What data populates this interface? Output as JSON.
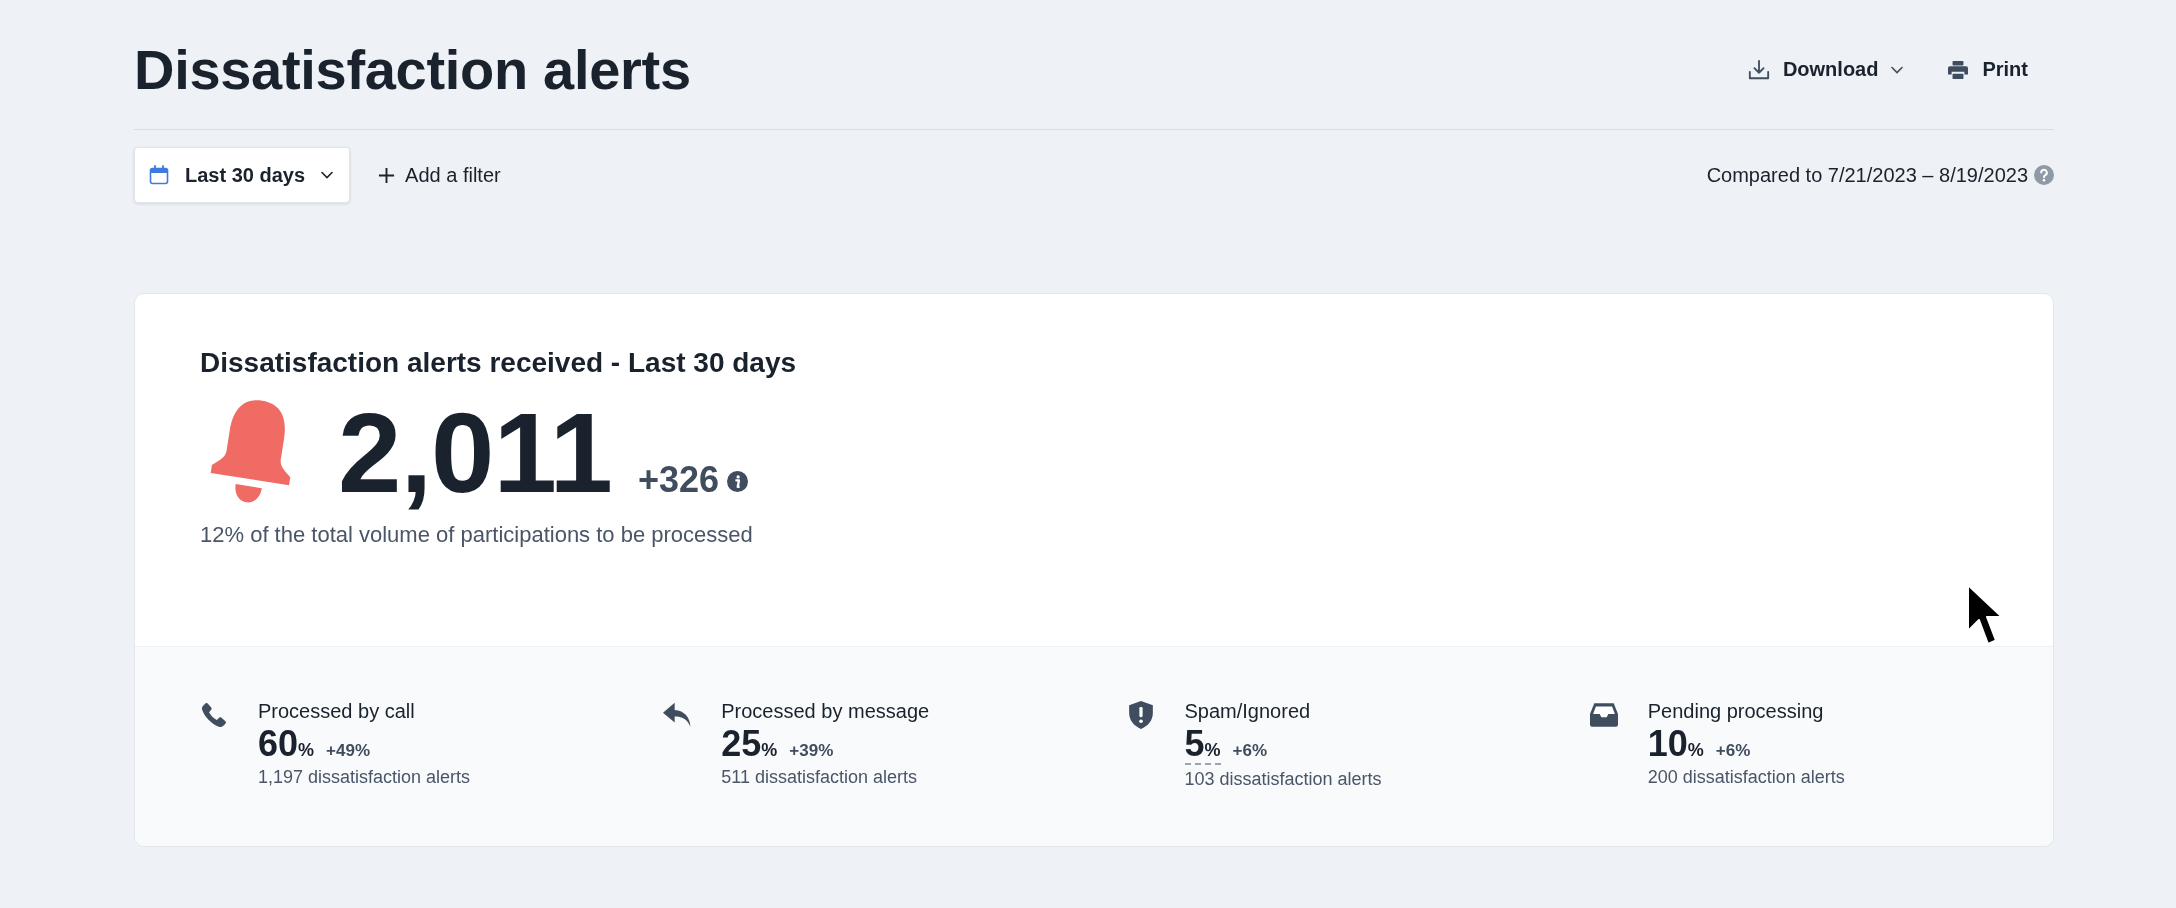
{
  "header": {
    "title": "Dissatisfaction alerts",
    "actions": [
      {
        "kind": "download",
        "label": "Download",
        "dropdown": true
      },
      {
        "kind": "print",
        "label": "Print",
        "dropdown": false
      }
    ]
  },
  "filters": {
    "period": {
      "label": "Last 30 days"
    },
    "add_filter": {
      "label": "Add a filter"
    },
    "comparison": "Compared to 7/21/2023 – 8/19/2023"
  },
  "summary": {
    "title": "Dissatisfaction alerts received - Last 30 days",
    "value": "2,011",
    "change": "+326",
    "note": "12% of the total volume of participations to be processed"
  },
  "stats": [
    {
      "kind": "call",
      "label": "Processed by call",
      "value": "60",
      "unit": "%",
      "change": "+49%",
      "detail": "1,197 dissatisfaction alerts",
      "underlined": false
    },
    {
      "kind": "message",
      "label": "Processed by message",
      "value": "25",
      "unit": "%",
      "change": "+39%",
      "detail": "511 dissatisfaction alerts",
      "underlined": false
    },
    {
      "kind": "spam",
      "label": "Spam/Ignored",
      "value": "5",
      "unit": "%",
      "change": "+6%",
      "detail": "103 dissatisfaction alerts",
      "underlined": true
    },
    {
      "kind": "pending",
      "label": "Pending processing",
      "value": "10",
      "unit": "%",
      "change": "+6%",
      "detail": "200 dissatisfaction alerts",
      "underlined": false
    }
  ]
}
